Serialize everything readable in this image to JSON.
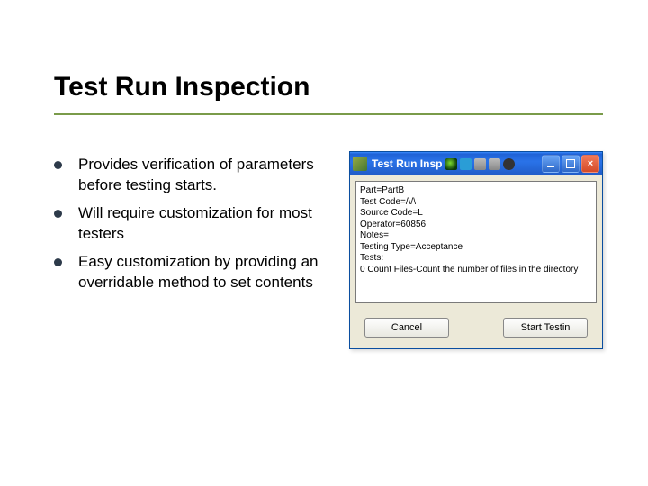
{
  "title": "Test Run Inspection",
  "bullets": [
    "Provides verification of parameters before testing starts.",
    "Will require customization for most testers",
    "Easy customization by providing an overridable method to set contents"
  ],
  "window": {
    "title": "Test Run Insp",
    "textpane": {
      "line1": "Part=PartB",
      "line2": "Test Code=/\\/\\",
      "line3": "Source Code=L",
      "line4": "Operator=60856",
      "line5": "Notes=",
      "line6": "Testing Type=Acceptance",
      "line7": "Tests:",
      "line8": "0 Count Files-Count the number of files in the directory"
    },
    "buttons": {
      "cancel": "Cancel",
      "start": "Start Testin"
    }
  }
}
